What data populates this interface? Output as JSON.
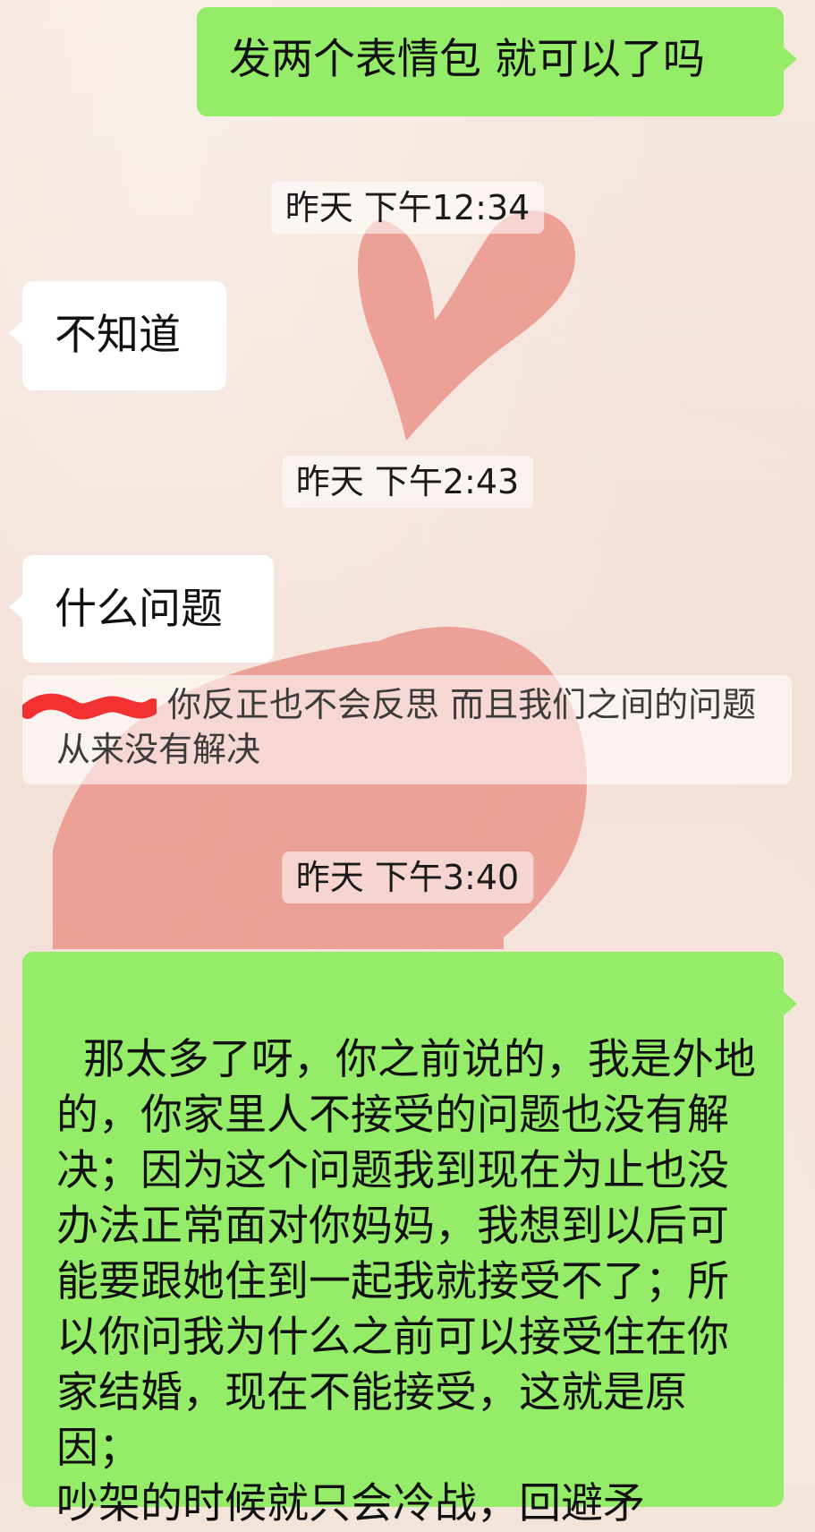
{
  "chat": {
    "messages": [
      {
        "side": "out",
        "text": "发两个表情包 就可以了吗"
      },
      {
        "type": "timestamp",
        "text": "昨天 下午12:34"
      },
      {
        "side": "in",
        "text": "不知道"
      },
      {
        "type": "timestamp",
        "text": "昨天 下午2:43"
      },
      {
        "side": "in",
        "text": "什么问题"
      },
      {
        "type": "quote",
        "text": "你反正也不会反思 而且我们之间的问题从来没有解决"
      },
      {
        "type": "timestamp",
        "text": "昨天 下午3:40"
      },
      {
        "side": "out",
        "text": "那太多了呀，你之前说的，我是外地的，你家里人不接受的问题也没有解决；因为这个问题我到现在为止也没办法正常面对你妈妈，我想到以后可能要跟她住到一起我就接受不了；所以你问我为什么之前可以接受住在你家结婚，现在不能接受，这就是原因；\n吵架的时候就只会冷战，回避矛"
      }
    ]
  },
  "theme": {
    "outgoing_bubble": "#95ec69",
    "incoming_bubble": "#ffffff",
    "background": "#f3e4da",
    "heart_color": "#e77b72"
  }
}
